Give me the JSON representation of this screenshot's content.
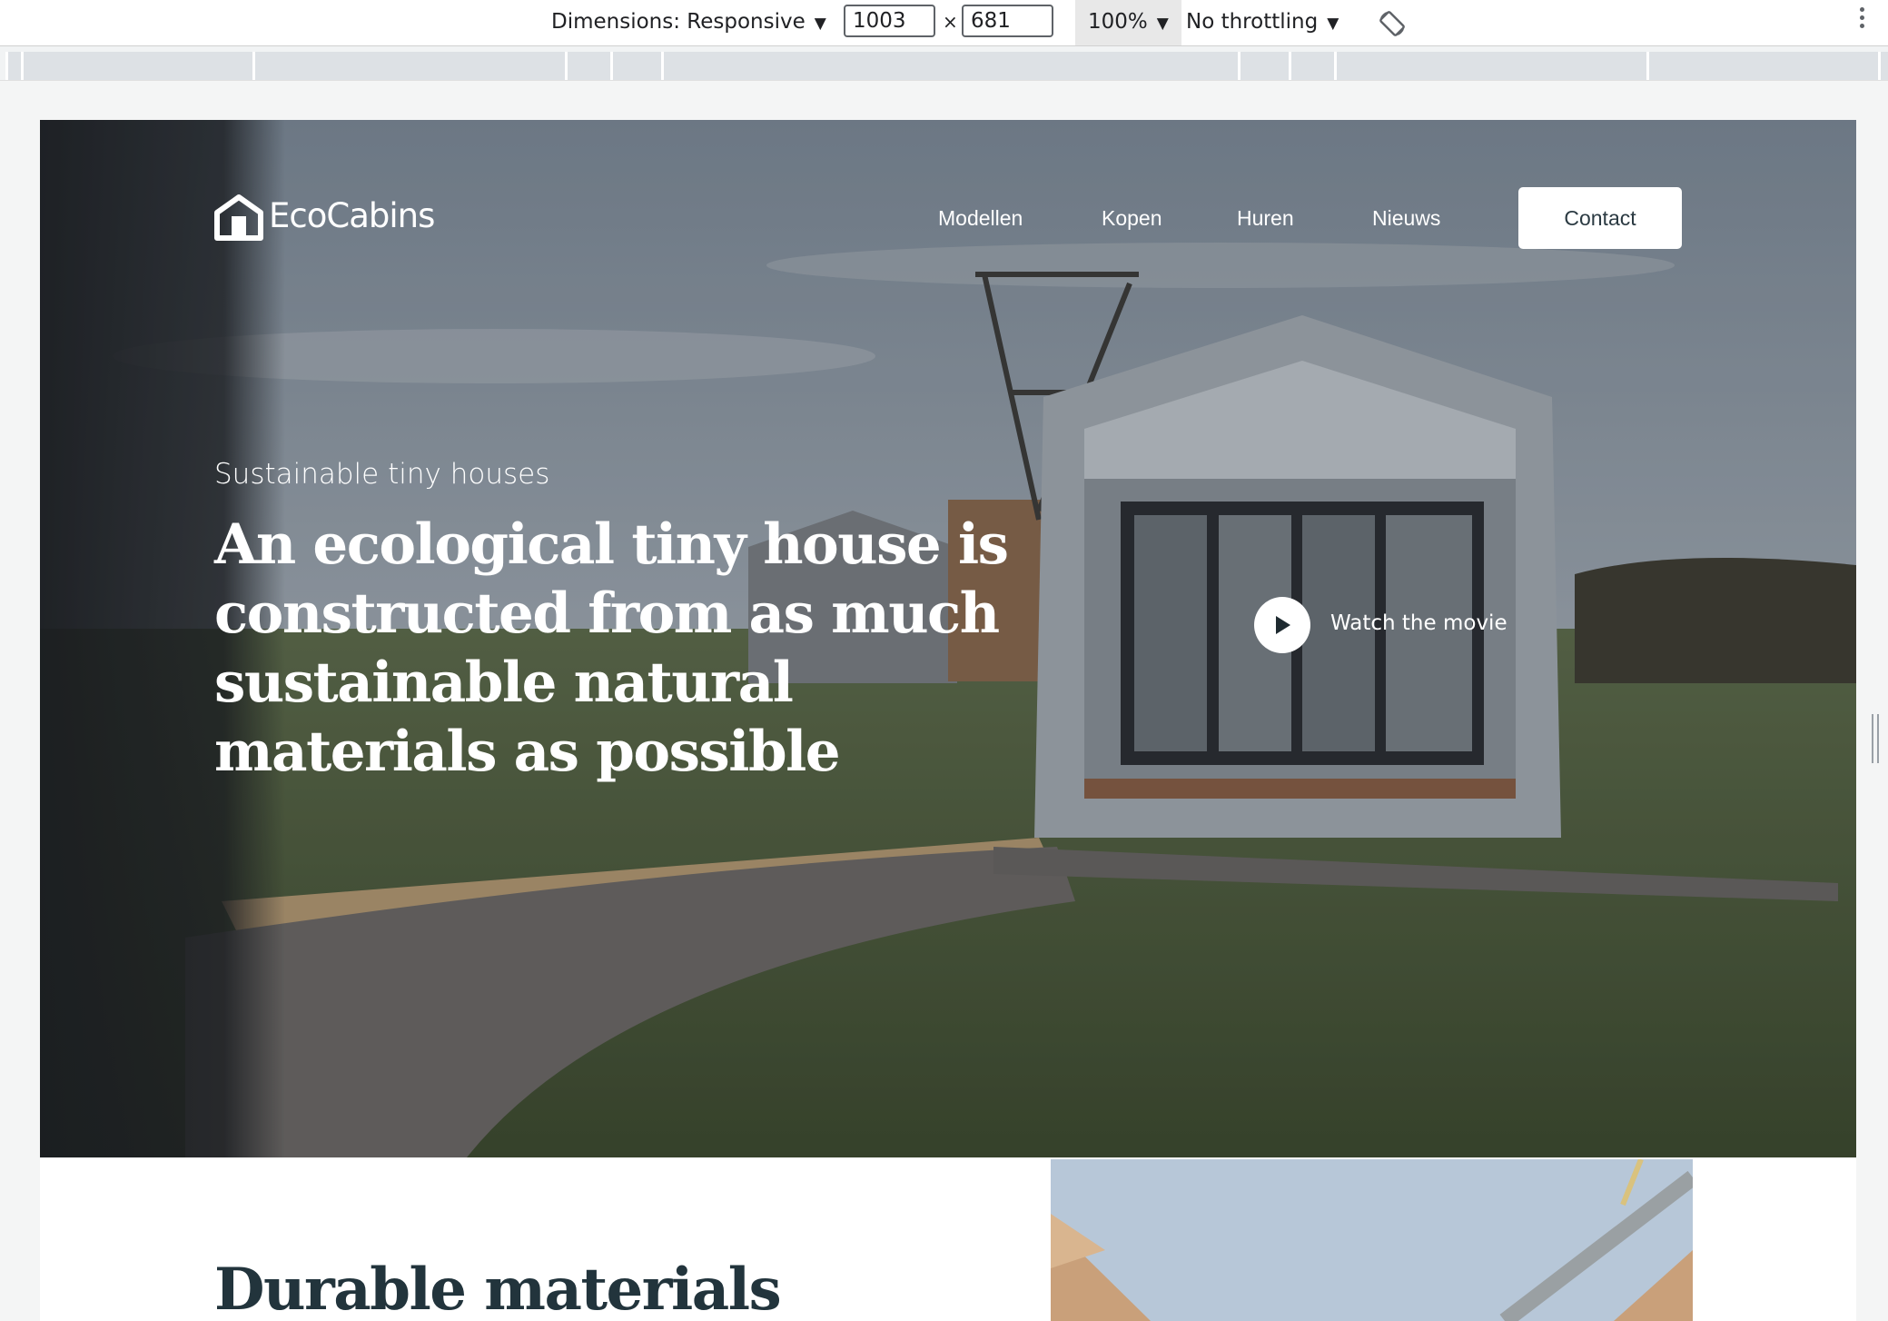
{
  "devtools": {
    "dimensions_label": "Dimensions: Responsive",
    "width_value": "1003",
    "height_value": "681",
    "times": "×",
    "zoom": "100%",
    "throttling": "No throttling",
    "dropdown_glyph": "▼"
  },
  "site": {
    "logo_text": "EcoCabins",
    "nav": {
      "modellen": "Modellen",
      "kopen": "Kopen",
      "huren": "Huren",
      "nieuws": "Nieuws",
      "contact": "Contact"
    },
    "hero": {
      "eyebrow": "Sustainable tiny houses",
      "headline": "An ecological tiny house is constructed from as much sustainable natural materials as possible",
      "watch_label": "Watch the movie"
    },
    "section": {
      "title": "Durable materials"
    }
  },
  "colors": {
    "contact_text": "#2b3a42",
    "section_title": "#22343c",
    "hero_text": "#ffffff"
  },
  "icons": {
    "logo": "house-logo-icon",
    "play": "play-icon",
    "rotate": "rotate-device-icon",
    "more": "more-vertical-icon"
  }
}
